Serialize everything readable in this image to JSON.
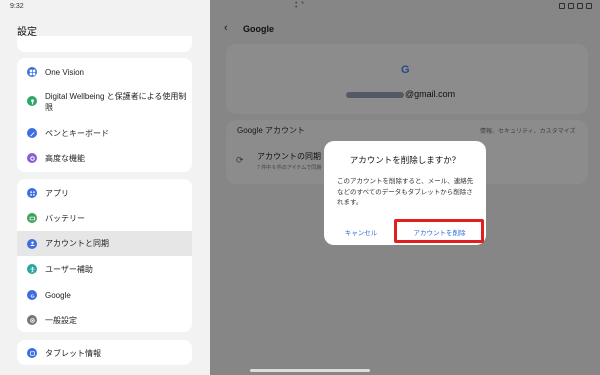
{
  "status": {
    "time": "9:32"
  },
  "left": {
    "title": "設定",
    "items": [
      {
        "label": "One Vision",
        "icon": "one-vision-icon",
        "color": "#3b6fe0"
      },
      {
        "label": "Digital Wellbeing と保護者による使用制限",
        "icon": "wellbeing-icon",
        "color": "#2fa66a"
      },
      {
        "label": "ペンとキーボード",
        "icon": "pen-icon",
        "color": "#3b6fe0"
      },
      {
        "label": "高度な機能",
        "icon": "advanced-features-icon",
        "color": "#8a5cd6"
      },
      {
        "label": "アプリ",
        "icon": "apps-icon",
        "color": "#3b6fe0"
      },
      {
        "label": "バッテリー",
        "icon": "battery-icon",
        "color": "#3aa35a"
      },
      {
        "label": "アカウントと同期",
        "icon": "account-icon",
        "color": "#3b6fe0",
        "active": true
      },
      {
        "label": "ユーザー補助",
        "icon": "accessibility-icon",
        "color": "#2aa6a0"
      },
      {
        "label": "Google",
        "icon": "google-icon",
        "color": "#3b6fe0"
      },
      {
        "label": "一般設定",
        "icon": "general-settings-icon",
        "color": "#777777"
      },
      {
        "label": "タブレット情報",
        "icon": "tablet-info-icon",
        "color": "#3b6fe0"
      }
    ]
  },
  "right": {
    "title": "Google",
    "google_logo": "G",
    "email_suffix": "@gmail.com",
    "section_label": "Google アカウント",
    "section_right": "情報、セキュリティ、カスタマイズ",
    "sync_title": "アカウントの同期",
    "sync_sub": "7 件中 6 件のアイテムで同期"
  },
  "dialog": {
    "title": "アカウントを削除しますか？",
    "body": "このアカウントを削除すると、メール、連絡先などのすべてのデータもタブレットから削除されます。",
    "cancel_label": "キャンセル",
    "delete_label": "アカウントを削除",
    "link_color": "#2f6bd8",
    "highlight_color": "#e0201e"
  }
}
